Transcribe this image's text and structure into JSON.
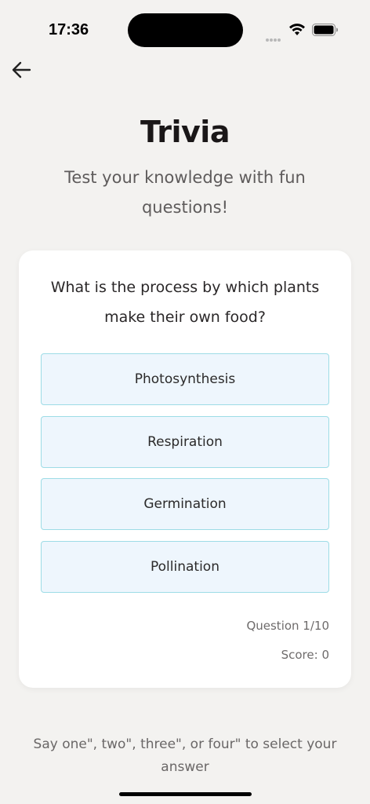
{
  "status_bar": {
    "time": "17:36",
    "icons": [
      "signal-dots-icon",
      "wifi-icon",
      "battery-icon"
    ]
  },
  "nav": {
    "back_icon": "arrow-left-icon"
  },
  "header": {
    "title": "Trivia",
    "subtitle": "Test your knowledge with fun questions!"
  },
  "quiz": {
    "question": "What is the process by which plants make their own food?",
    "options": [
      {
        "label": "Photosynthesis"
      },
      {
        "label": "Respiration"
      },
      {
        "label": "Germination"
      },
      {
        "label": "Pollination"
      }
    ],
    "progress_label": "Question 1/10",
    "score_label": "Score: 0"
  },
  "footer": {
    "voice_hint": "Say one\", two\", three\", or four\" to select your answer"
  },
  "colors": {
    "background": "#f3f2f0",
    "card": "#ffffff",
    "option_fill": "#eef6fd",
    "option_border": "#9ddce6"
  }
}
